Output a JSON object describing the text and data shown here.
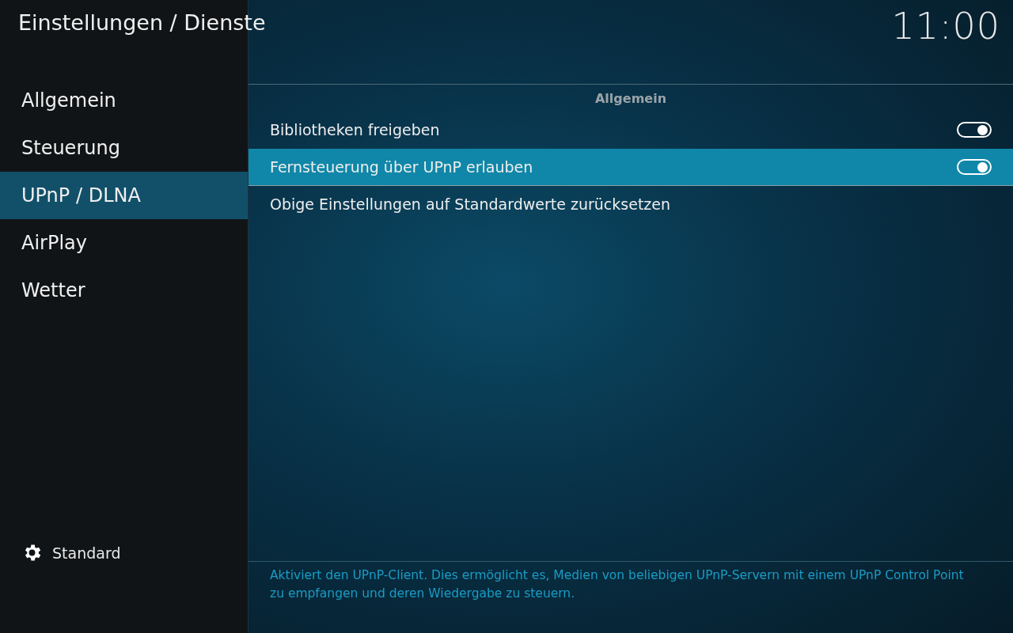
{
  "header": {
    "title": "Einstellungen / Dienste",
    "clock": "11:00"
  },
  "sidebar": {
    "items": [
      {
        "label": "Allgemein",
        "selected": false
      },
      {
        "label": "Steuerung",
        "selected": false
      },
      {
        "label": "UPnP / DLNA",
        "selected": true
      },
      {
        "label": "AirPlay",
        "selected": false
      },
      {
        "label": "Wetter",
        "selected": false
      }
    ],
    "level_button": {
      "label": "Standard"
    }
  },
  "section": {
    "title": "Allgemein",
    "settings": [
      {
        "kind": "toggle",
        "label": "Bibliotheken freigeben",
        "on": true,
        "selected": false
      },
      {
        "kind": "toggle",
        "label": "Fernsteuerung über UPnP erlauben",
        "on": true,
        "selected": true
      },
      {
        "kind": "action",
        "label": "Obige Einstellungen auf Standardwerte zurücksetzen",
        "selected": false
      }
    ]
  },
  "description": "Aktiviert den UPnP-Client. Dies ermöglicht es, Medien von beliebigen UPnP-Servern mit einem UPnP Control Point zu empfangen und deren Wiedergabe zu steuern."
}
